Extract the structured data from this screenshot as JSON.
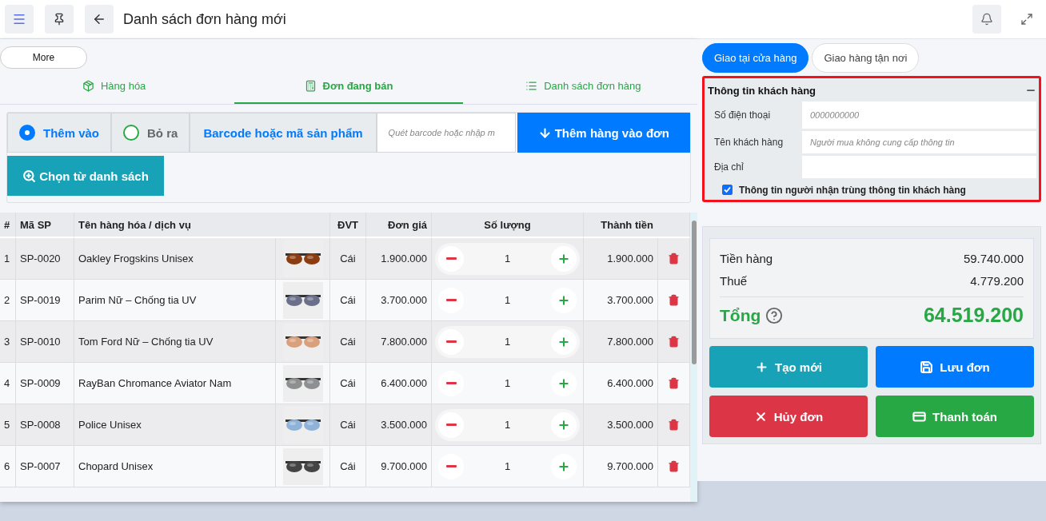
{
  "header": {
    "title": "Danh sách đơn hàng mới"
  },
  "more_button": "More",
  "main_tabs": [
    {
      "label": "Hàng hóa",
      "selected": false
    },
    {
      "label": "Đơn đang bán",
      "selected": true
    },
    {
      "label": "Danh sách đơn hàng",
      "selected": false
    }
  ],
  "modes": [
    {
      "label": "Thêm vào",
      "selected": true
    },
    {
      "label": "Bỏ ra",
      "selected": false
    }
  ],
  "barcode": {
    "label": "Barcode hoặc mã sản phẩm",
    "placeholder": "Quét barcode hoặc nhập m"
  },
  "add_button": "Thêm hàng vào đơn",
  "choose_button": "Chọn từ danh sách",
  "table": {
    "columns": [
      "#",
      "Mã SP",
      "Tên hàng hóa / dịch vụ",
      "ĐVT",
      "Đơn giá",
      "Số lượng",
      "Thành tiền"
    ],
    "rows": [
      {
        "index": "1",
        "code": "SP-0020",
        "name": "Oakley Frogskins Unisex",
        "unit": "Cái",
        "price": "1.900.000",
        "quantity": "1",
        "total": "1.900.000"
      },
      {
        "index": "2",
        "code": "SP-0019",
        "name": "Parim Nữ – Chống tia UV",
        "unit": "Cái",
        "price": "3.700.000",
        "quantity": "1",
        "total": "3.700.000"
      },
      {
        "index": "3",
        "code": "SP-0010",
        "name": "Tom Ford Nữ – Chống tia UV",
        "unit": "Cái",
        "price": "7.800.000",
        "quantity": "1",
        "total": "7.800.000"
      },
      {
        "index": "4",
        "code": "SP-0009",
        "name": "RayBan Chromance Aviator Nam",
        "unit": "Cái",
        "price": "6.400.000",
        "quantity": "1",
        "total": "6.400.000"
      },
      {
        "index": "5",
        "code": "SP-0008",
        "name": "Police Unisex",
        "unit": "Cái",
        "price": "3.500.000",
        "quantity": "1",
        "total": "3.500.000"
      },
      {
        "index": "6",
        "code": "SP-0007",
        "name": "Chopard Unisex",
        "unit": "Cái",
        "price": "9.700.000",
        "quantity": "1",
        "total": "9.700.000"
      }
    ]
  },
  "delivery_tabs": [
    {
      "label": "Giao tại cửa hàng",
      "selected": true
    },
    {
      "label": "Giao hàng tận nơi",
      "selected": false
    }
  ],
  "customer": {
    "title": "Thông tin khách hàng",
    "fields": [
      {
        "label": "Số điện thoại",
        "placeholder": "0000000000"
      },
      {
        "label": "Tên khách hàng",
        "placeholder": "Người mua không cung cấp thông tin"
      },
      {
        "label": "Địa chỉ"
      }
    ],
    "same_recipient": {
      "label": "Thông tin người nhận trùng thông tin khách hàng",
      "checked": true
    }
  },
  "summary": {
    "subtotal_label": "Tiền hàng",
    "subtotal": "59.740.000",
    "tax_label": "Thuế",
    "tax": "4.779.200",
    "total_label": "Tổng",
    "total": "64.519.200"
  },
  "actions": [
    {
      "label": "Tạo mới",
      "kind": "create"
    },
    {
      "label": "Lưu đơn",
      "kind": "save"
    },
    {
      "label": "Hủy đơn",
      "kind": "cancel"
    },
    {
      "label": "Thanh toán",
      "kind": "pay"
    }
  ]
}
